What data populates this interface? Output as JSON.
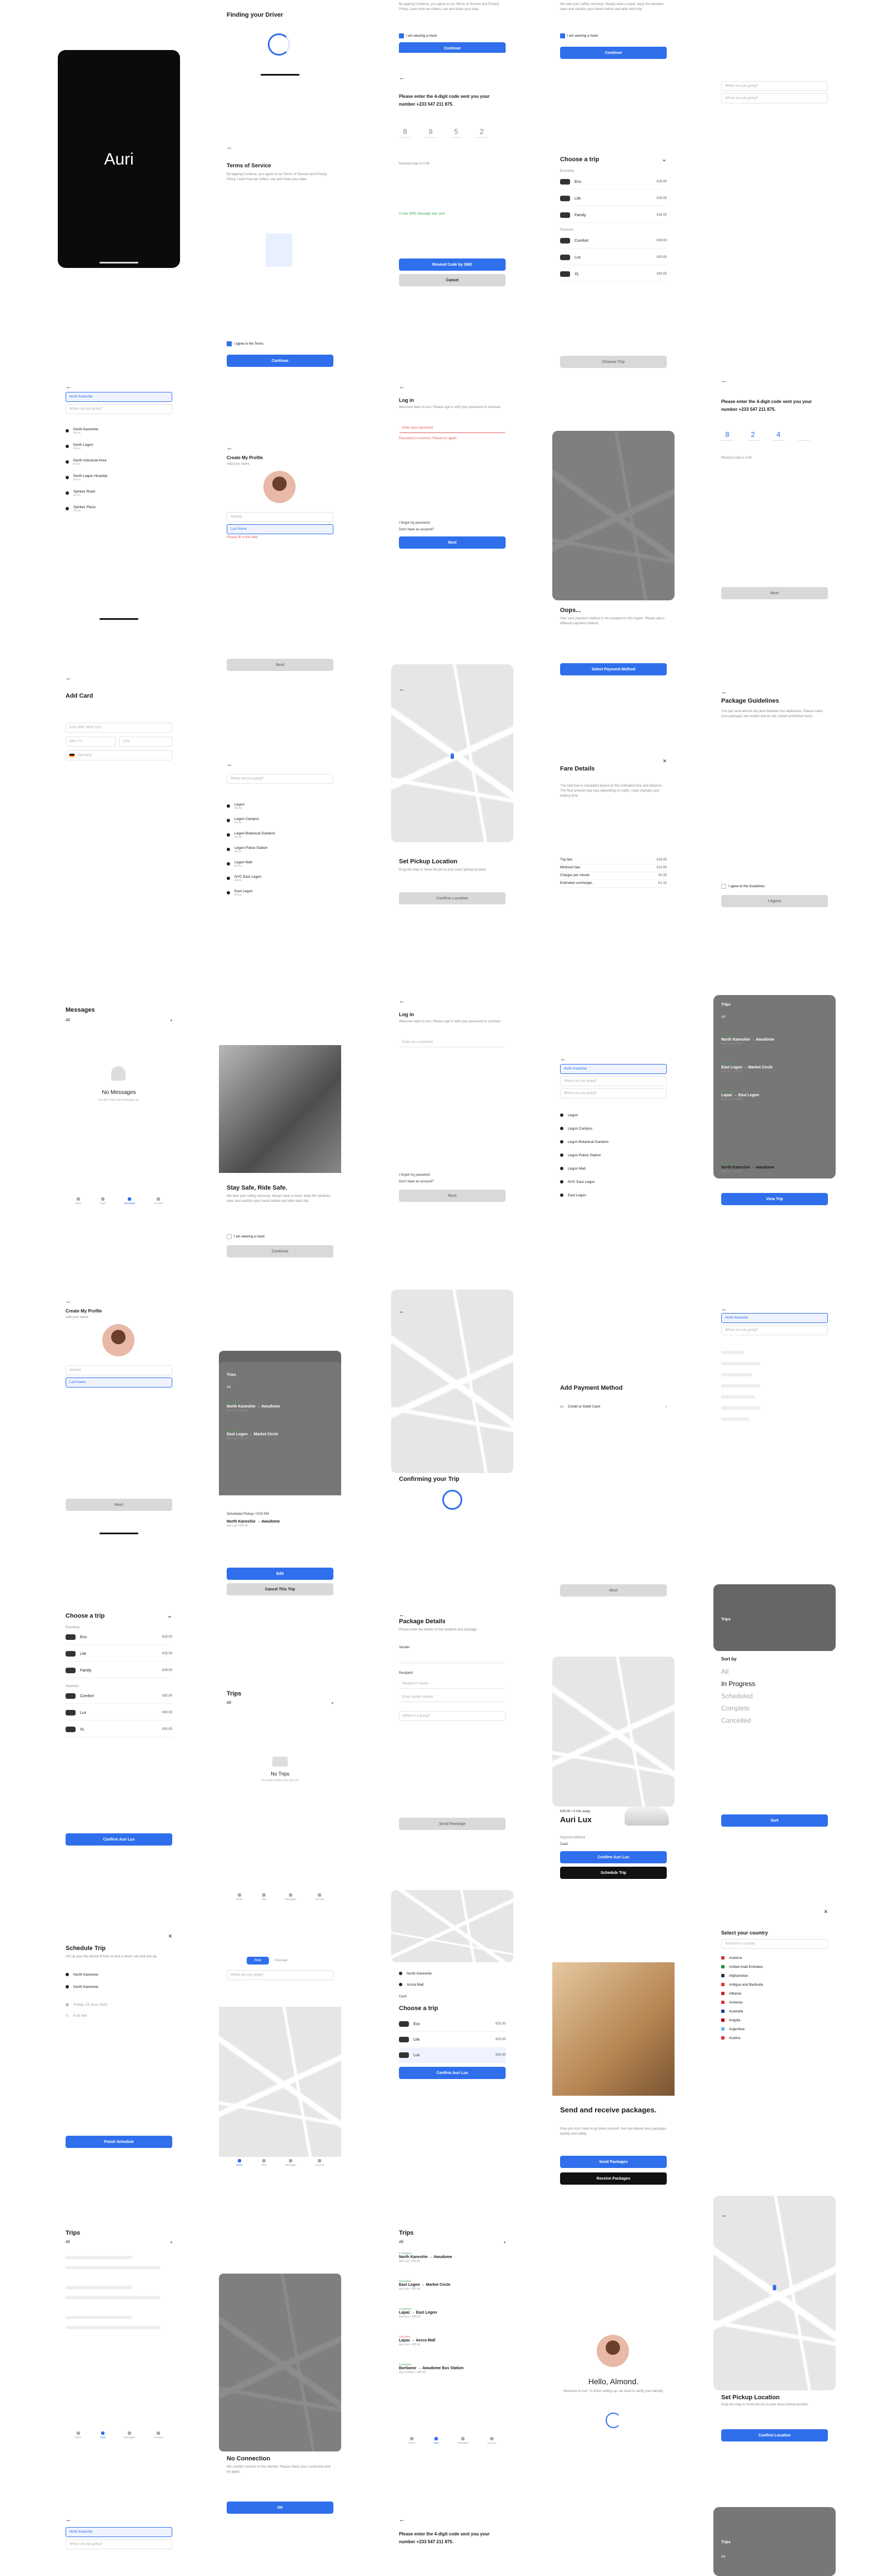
{
  "status": {
    "time": "9:41",
    "signal": "▮▮▮ ◠ ▭"
  },
  "splash": {
    "logo": "Auri"
  },
  "finding": {
    "title": "Finding your Driver"
  },
  "terms": {
    "title": "Terms of Service",
    "body": "By tapping Continue, you agree to our Terms of Service and Privacy Policy. Learn how we collect, use and share your data.",
    "agree": "I agree to the Terms",
    "cta": "Continue"
  },
  "otp": {
    "title": "Please enter the 4-digit code sent you your number +233 547 211 875.",
    "digits": [
      "8",
      "9",
      "5",
      "2"
    ],
    "resend_hint": "Resend code in 0:45",
    "sent_note": "A new SMS message was sent",
    "resend_btn": "Resend Code by SMS",
    "cancel_btn": "Cancel"
  },
  "choose": {
    "title": "Choose a trip",
    "economy": "Economy",
    "premium": "Premium",
    "options": [
      {
        "name": "Eco",
        "price": "¢25.00"
      },
      {
        "name": "Lite",
        "price": "¢25.00"
      },
      {
        "name": "Family",
        "price": "¢28.00"
      },
      {
        "name": "Comfort",
        "price": "¢30.00"
      },
      {
        "name": "Lux",
        "price": "¢30.00"
      },
      {
        "name": "XL",
        "price": "¢30.00"
      }
    ],
    "cta": "Choose Trip",
    "confirm": "Confirm Auri Lux"
  },
  "search": {
    "where_from": "North Kaneshie",
    "where_to": "Where are you going?",
    "results": [
      {
        "name": "North Kaneshie",
        "sub": "Accra"
      },
      {
        "name": "North Legon",
        "sub": "Accra"
      },
      {
        "name": "North Industrial Area",
        "sub": "Accra"
      },
      {
        "name": "North Legon Hospital",
        "sub": "Accra"
      },
      {
        "name": "Spintex Road",
        "sub": "Accra"
      },
      {
        "name": "Spintex Plaza",
        "sub": "Accra"
      }
    ],
    "legon": [
      {
        "name": "Legon",
        "sub": "Accra"
      },
      {
        "name": "Legon Campus",
        "sub": "Accra"
      },
      {
        "name": "Legon Botanical Gardens",
        "sub": "Accra"
      },
      {
        "name": "Legon Police Station",
        "sub": "Accra"
      },
      {
        "name": "Legon Mall",
        "sub": "Accra"
      },
      {
        "name": "NYC East Legon",
        "sub": "Accra"
      },
      {
        "name": "East Legon",
        "sub": "Accra"
      }
    ]
  },
  "profile": {
    "title": "Create My Profile",
    "subtitle": "Add your name",
    "first": "Almond",
    "last": "Last Name",
    "error": "Please fill in this field",
    "cta": "Next"
  },
  "login": {
    "title": "Log in",
    "hint": "Welcome back to Auri. Please sign in with your password to continue.",
    "placeholder": "Enter your password",
    "error": "Password is incorrect. Please try again.",
    "forgot": "I forgot my password",
    "no_account": "Don't have an account?",
    "cta": "Next"
  },
  "oops": {
    "title": "Oops...",
    "body": "Your card payment method is not accepted in this region. Please add a different payment method.",
    "cta": "Select Payment Method"
  },
  "otp2": {
    "digits": [
      "8",
      "2",
      "4"
    ],
    "cta": "Next"
  },
  "card": {
    "title": "Add Card",
    "number": "0123 4567 8910 1112",
    "exp": "MM / YY",
    "cvv": "CVV",
    "country": "Germany"
  },
  "pickup": {
    "title": "Set Pickup Location",
    "hint": "Drag the map to move the pin to your exact pickup location.",
    "cta": "Confirm Location",
    "search": "Where are you going?"
  },
  "fare": {
    "title": "Fare Details",
    "body": "The total fare is calculated based on the estimated time and distance. The final amount may vary depending on traffic, route changes and waiting time.",
    "rows": [
      {
        "k": "Trip fare",
        "v": "¢25.00"
      },
      {
        "k": "Minimum fare",
        "v": "¢10.00"
      },
      {
        "k": "Charges per minute",
        "v": "¢0.30"
      },
      {
        "k": "Estimated surcharges",
        "v": "¢1.10"
      }
    ]
  },
  "guidelines": {
    "title": "Package Guidelines",
    "body": "You can send almost any item between two addresses. Please make sure packages are sealed and do not contain prohibited items.",
    "agree": "I agree to the Guidelines",
    "cta": "I Agree"
  },
  "messages": {
    "title": "Messages",
    "filter": "All",
    "empty_title": "No Messages",
    "empty_sub": "You don't have any messages yet."
  },
  "safety": {
    "title": "Stay Safe, Ride Safe.",
    "body": "We take your safety seriously. Always wear a mask, keep the windows open and sanitize your hands before and after each trip.",
    "check": "I am wearing a mask",
    "cta": "Continue"
  },
  "trips": {
    "title": "Trips",
    "filter": "All",
    "items": [
      {
        "tag": "In Progress",
        "route": "North Kaneshie → Awudome",
        "meta": "Auri Lux • ¢30.00"
      },
      {
        "tag": "Scheduled",
        "route": "East Legon → Market Circle",
        "meta": "Auri Lite • ¢25.00"
      },
      {
        "tag": "Completed",
        "route": "Lapaz → East Legon",
        "meta": "Auri Eco • ¢25.00"
      },
      {
        "tag": "Cancelled",
        "route": "Lapaz → Accra Mall",
        "meta": "Auri Lux • ¢30.00"
      },
      {
        "tag": "Completed",
        "route": "Bortianor → Awudome Bus Station",
        "meta": "Auri Comfort • ¢30.00"
      }
    ],
    "view": "View Trip",
    "edit": "Edit",
    "cancel": "Cancel This Trip",
    "scheduled": "Scheduled Pickup • 9:00 PM",
    "empty": "No Trips",
    "empty_sub": "You haven't taken any trips yet."
  },
  "confirming": {
    "title": "Confirming your Trip"
  },
  "payment": {
    "title": "Add Payment Method",
    "option": "Credit or Debit Card",
    "cta": "Next"
  },
  "package": {
    "title": "Package Details",
    "hint": "Please enter the details of the recipient and package.",
    "sender": "Sender",
    "recipient": "Recipient",
    "name": "Recipient's Name",
    "phone": "Enter mobile number",
    "where": "Where is it going?",
    "cta": "Send Package"
  },
  "lux": {
    "eta": "¢30.00 • 4 min away",
    "name": "Auri Lux",
    "pay_label": "Payment Method",
    "pay": "Cash",
    "confirm": "Confirm Auri Lux",
    "schedule": "Schedule Trip"
  },
  "sort": {
    "title": "Sort by",
    "options": [
      "All",
      "In Progress",
      "Scheduled",
      "Complete",
      "Cancelled"
    ],
    "cta": "Sort"
  },
  "schedule": {
    "title": "Schedule Trip",
    "hint": "Set up your trip ahead of time so that a driver can pick you up.",
    "from": "North Kaneshie",
    "to": "North Kaneshie",
    "date": "Friday, 23 June 2023",
    "time": "4:00 PM",
    "cta": "Finish Schedule"
  },
  "home": {
    "ride": "Ride",
    "package": "Package",
    "where": "Where are you going?",
    "tabs": [
      "Home",
      "Trips",
      "Messages",
      "Account"
    ]
  },
  "sendpkg": {
    "title": "Send and receive packages.",
    "body": "Now you don't need to go there yourself. Auri can deliver your packages quickly and safely.",
    "send": "Send Packages",
    "receive": "Receive Packages"
  },
  "country": {
    "title": "Select your country",
    "search": "Search for a country",
    "list": [
      "Andorra",
      "United Arab Emirates",
      "Afghanistan",
      "Antigua and Barbuda",
      "Albania",
      "Armenia",
      "Australia",
      "Angola",
      "Argentina",
      "Austria"
    ]
  },
  "noconn": {
    "title": "No Connection",
    "body": "We couldn't connect to the internet. Please check your connection and try again.",
    "cta": "OK"
  },
  "hello": {
    "title": "Hello, Almond.",
    "body": "Welcome to Auri. To finish setting up, we need to verify your identity."
  },
  "ride": {
    "from": "North Kaneshie",
    "to": "Accra Mall",
    "pay": "Cash"
  }
}
